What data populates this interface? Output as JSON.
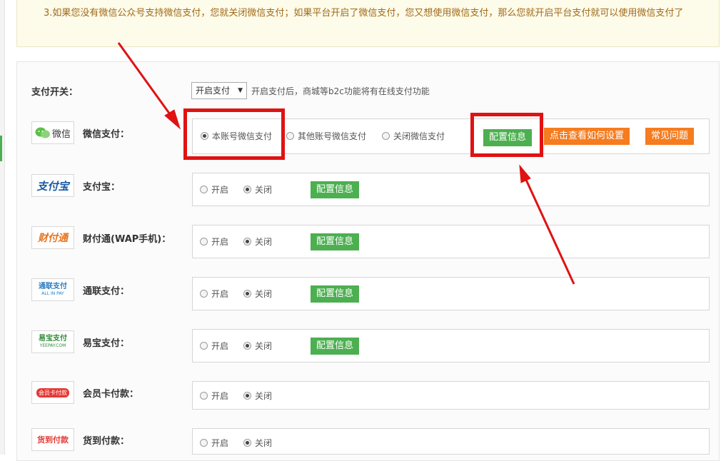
{
  "notice": {
    "text": "3.如果您没有微信公众号支持微信支付，您就关闭微信支付；如果平台开启了微信支付，您又想使用微信支付，那么您就开启平台支付就可以使用微信支付了"
  },
  "switch": {
    "label": "支付开关：",
    "selected": "开启支付",
    "hint": "开启支付后，商城等b2c功能将有在线支付功能"
  },
  "wechat": {
    "name": "微信支付：",
    "logo_text": "微信",
    "options": [
      "本账号微信支付",
      "其他账号微信支付",
      "关闭微信支付"
    ],
    "selected_index": 0,
    "config_button": "配置信息",
    "howto_button": "点击查看如何设置",
    "faq_button": "常见问题"
  },
  "providers": [
    {
      "id": "alipay",
      "name": "支付宝：",
      "logo_text": "支付宝",
      "options": [
        "开启",
        "关闭"
      ],
      "selected_index": 1,
      "config_button": "配置信息"
    },
    {
      "id": "tenpay",
      "name": "财付通(WAP手机)：",
      "logo_text": "财付通",
      "options": [
        "开启",
        "关闭"
      ],
      "selected_index": 1,
      "config_button": "配置信息"
    },
    {
      "id": "allinpay",
      "name": "通联支付：",
      "logo_text": "通联支付",
      "sub_text": "ALL IN PAY",
      "options": [
        "开启",
        "关闭"
      ],
      "selected_index": 1,
      "config_button": "配置信息"
    },
    {
      "id": "yeepay",
      "name": "易宝支付：",
      "logo_text": "易宝支付",
      "sub_text": "YEEPAY.COM",
      "options": [
        "开启",
        "关闭"
      ],
      "selected_index": 1,
      "config_button": "配置信息"
    },
    {
      "id": "member",
      "name": "会员卡付款：",
      "logo_text": "会员卡付款",
      "options": [
        "开启",
        "关闭"
      ],
      "selected_index": 1
    },
    {
      "id": "cod",
      "name": "货到付款：",
      "logo_text": "货到付款",
      "options": [
        "开启",
        "关闭"
      ],
      "selected_index": 1
    }
  ],
  "colors": {
    "accent_green": "#4caf50",
    "accent_orange": "#f57c1f",
    "highlight_red": "#e01212",
    "notice_text": "#a06a1b"
  }
}
